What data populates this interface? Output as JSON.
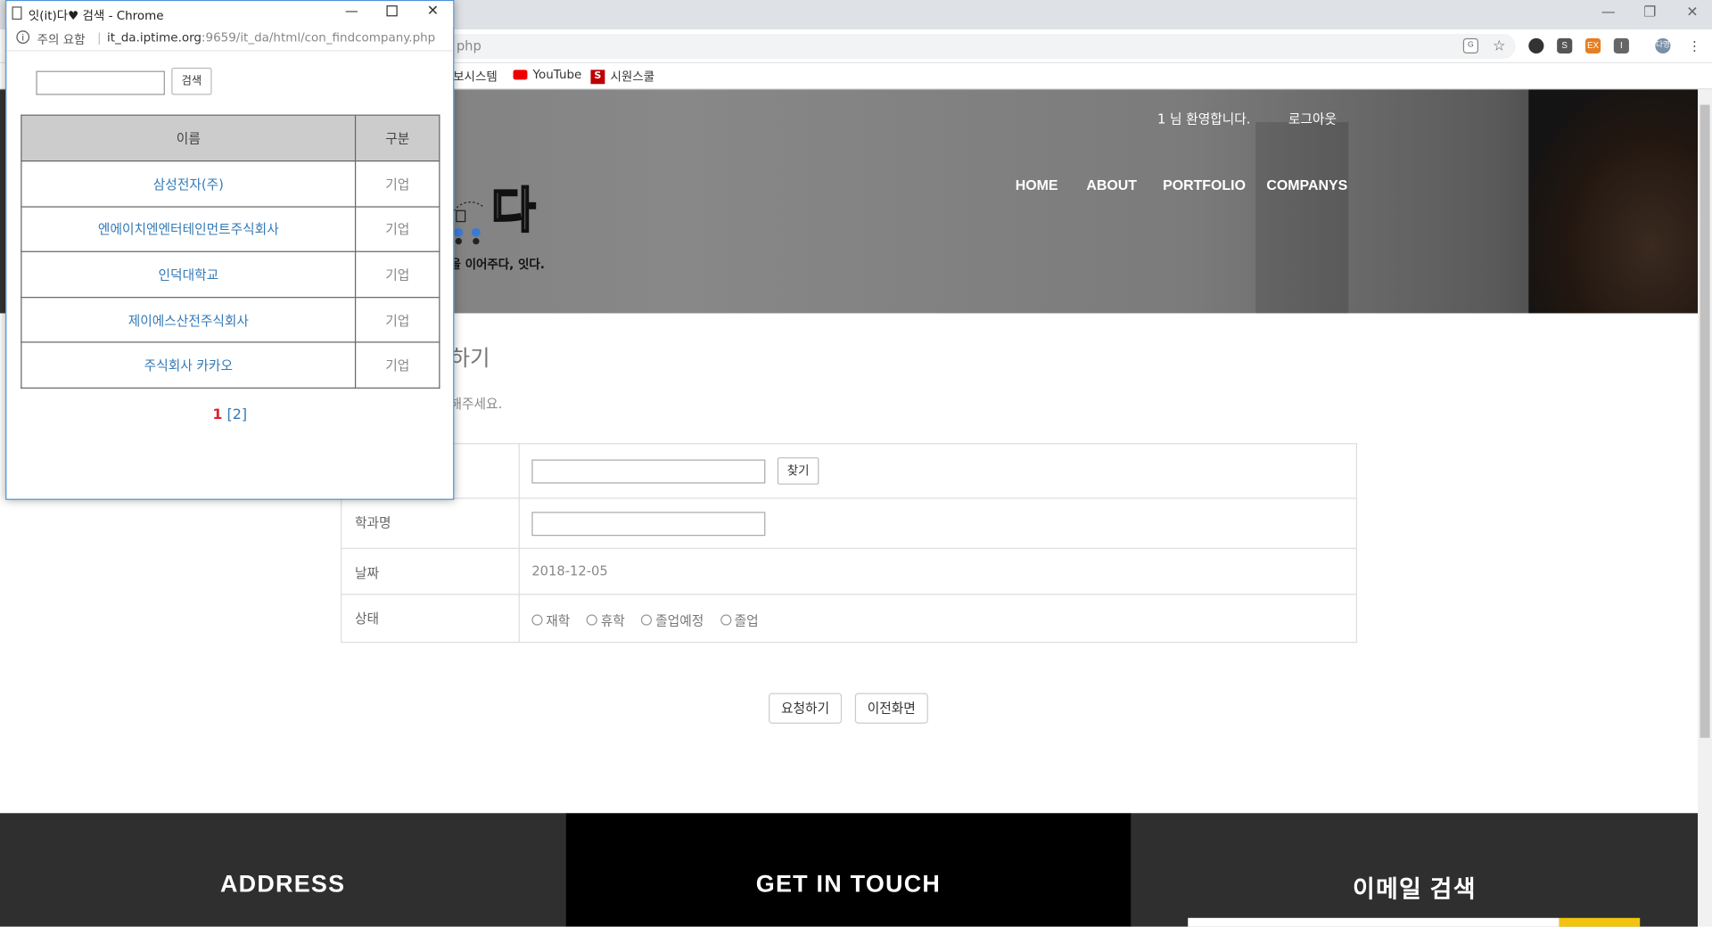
{
  "browser": {
    "url_tail": "php",
    "bookmarks": [
      {
        "label": "보시스템"
      },
      {
        "label": "YouTube"
      },
      {
        "label": "시원스쿨"
      }
    ],
    "profile_label": "다영"
  },
  "site": {
    "welcome": "1 님 환영합니다.",
    "logout": "로그아웃",
    "nav": [
      "HOME",
      "ABOUT",
      "PORTFOLIO",
      "COMPANYS"
    ],
    "logo_char": "다",
    "tagline": "을 이어주다, 잇다."
  },
  "page": {
    "title": "하기",
    "desc": "해주세요.",
    "form": {
      "find_label": "찾기",
      "dept_label": "학과명",
      "date_label": "날짜",
      "date_value": "2018-12-05",
      "status_label": "상태",
      "status_options": [
        "재학",
        "휴학",
        "졸업예정",
        "졸업"
      ]
    },
    "submit": "요청하기",
    "back": "이전화면"
  },
  "footer": {
    "address": "ADDRESS",
    "touch": "GET IN TOUCH",
    "email": "이메일 검색",
    "colors": {
      "left": "#2f2f2f",
      "mid": "#000000",
      "right": "#2f2f2f",
      "accent": "#f1c40f"
    }
  },
  "popup": {
    "title": "잇(it)다♥ 검색 - Chrome",
    "security": "주의 요함",
    "url": "it_da.iptime.org",
    "url_path": ":9659/it_da/html/con_findcompany.php",
    "search_btn": "검색",
    "headers": {
      "name": "이름",
      "type": "구분"
    },
    "rows": [
      {
        "name": "삼성전자(주)",
        "type": "기업"
      },
      {
        "name": "엔에이치엔엔터테인먼트주식회사",
        "type": "기업"
      },
      {
        "name": "인덕대학교",
        "type": "기업"
      },
      {
        "name": "제이에스산전주식회사",
        "type": "기업"
      },
      {
        "name": "주식회사 카카오",
        "type": "기업"
      }
    ],
    "pager": {
      "current": "1",
      "next": "[2]"
    }
  }
}
